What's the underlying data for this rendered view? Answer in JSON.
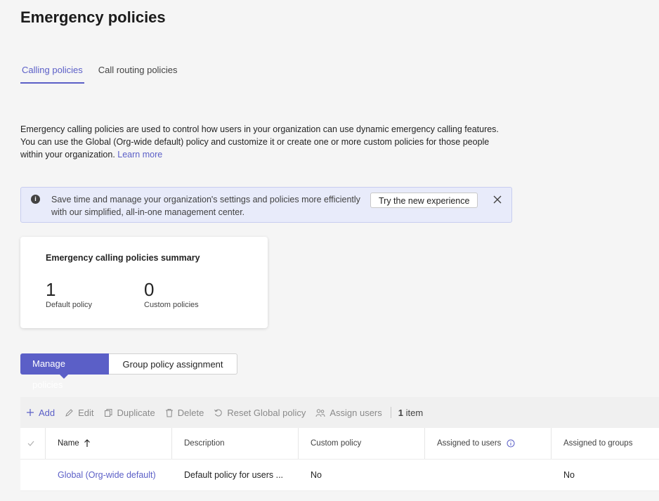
{
  "page": {
    "title": "Emergency policies"
  },
  "tabs": [
    {
      "label": "Calling policies",
      "active": true
    },
    {
      "label": "Call routing policies",
      "active": false
    }
  ],
  "description": {
    "text": "Emergency calling policies are used to control how users in your organization can use dynamic emergency calling features. You can use the Global (Org-wide default) policy and customize it or create one or more custom policies for those people within your organization.",
    "link": "Learn more"
  },
  "banner": {
    "text": "Save time and manage your organization's settings and policies more efficiently with our simplified, all-in-one management center.",
    "button": "Try the new experience"
  },
  "summary": {
    "title": "Emergency calling policies summary",
    "default_count": "1",
    "default_label": "Default policy",
    "custom_count": "0",
    "custom_label": "Custom policies"
  },
  "segments": [
    {
      "label": "Manage policies",
      "active": true
    },
    {
      "label": "Group policy assignment",
      "active": false
    }
  ],
  "toolbar": {
    "add": "Add",
    "edit": "Edit",
    "duplicate": "Duplicate",
    "delete": "Delete",
    "reset": "Reset Global policy",
    "assign": "Assign users",
    "count_number": "1",
    "count_label": "item"
  },
  "table": {
    "headers": [
      "Name",
      "Description",
      "Custom policy",
      "Assigned to users",
      "Assigned to groups"
    ],
    "rows": [
      [
        "Global (Org-wide default)",
        "Default policy for users ...",
        "No",
        "",
        "No"
      ]
    ]
  },
  "colors": {
    "accent": "#5b5fc7",
    "banner_bg": "#e8ebfa"
  }
}
